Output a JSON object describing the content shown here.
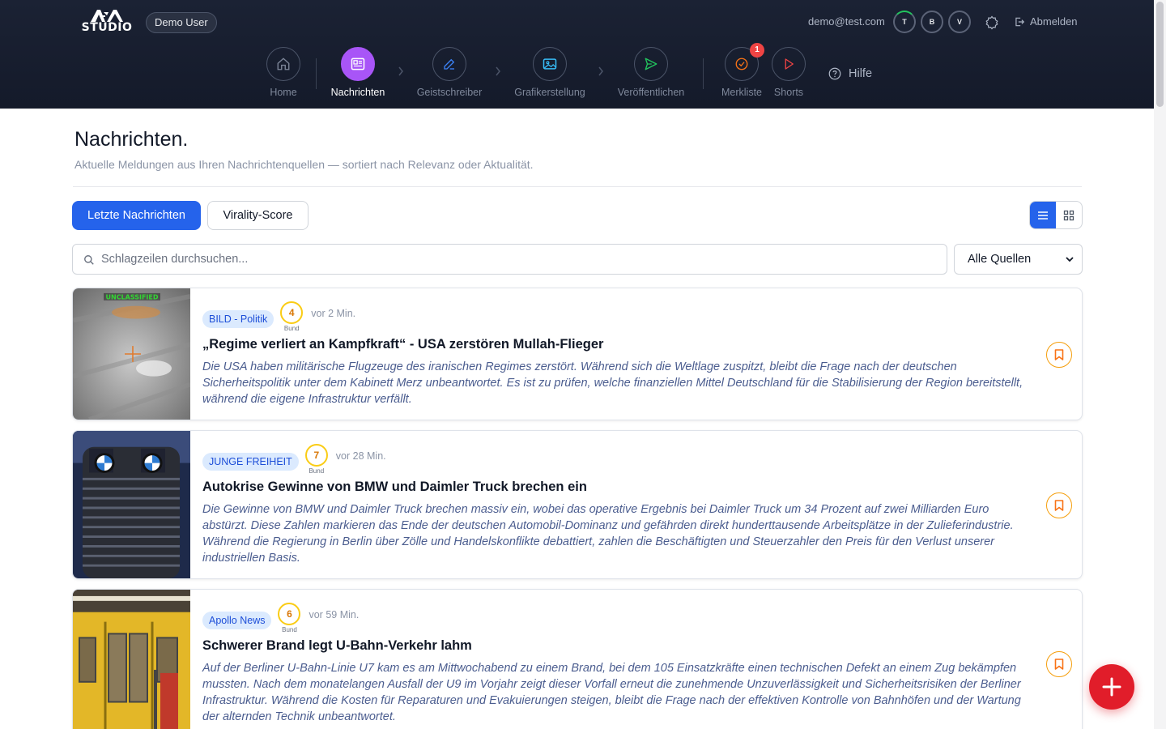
{
  "header": {
    "logo_text": "STUDIO",
    "user_label": "Demo User",
    "email": "demo@test.com",
    "profile_buttons": [
      "T",
      "B",
      "V"
    ],
    "logout_label": "Abmelden",
    "help_label": "Hilfe",
    "nav": [
      {
        "label": "Home",
        "icon": "home-icon",
        "active": false
      },
      {
        "label": "Nachrichten",
        "icon": "newspaper-icon",
        "active": true
      },
      {
        "label": "Geistschreiber",
        "icon": "pencil-icon",
        "active": false
      },
      {
        "label": "Grafikerstellung",
        "icon": "image-icon",
        "active": false
      },
      {
        "label": "Veröffentlichen",
        "icon": "send-icon",
        "active": false
      },
      {
        "label": "Merkliste",
        "icon": "check-circle-icon",
        "active": false,
        "badge": "1"
      },
      {
        "label": "Shorts",
        "icon": "play-icon",
        "active": false
      }
    ]
  },
  "page": {
    "title": "Nachrichten.",
    "subtitle": "Aktuelle Meldungen aus Ihren Nachrichtenquellen — sortiert nach Relevanz oder Aktualität."
  },
  "tabs": {
    "latest": "Letzte Nachrichten",
    "virality": "Virality-Score"
  },
  "search": {
    "placeholder": "Schlagzeilen durchsuchen..."
  },
  "source_filter": {
    "selected": "Alle Quellen"
  },
  "articles": [
    {
      "source": "BILD - Politik",
      "score": "4",
      "score_label": "Bund",
      "time": "vor 2 Min.",
      "thumb_label": "UNCLASSIFIED",
      "title": "„Regime verliert an Kampfkraft“ - USA zerstören Mullah-Flieger",
      "description": "Die USA haben militärische Flugzeuge des iranischen Regimes zerstört. Während sich die Weltlage zuspitzt, bleibt die Frage nach der deutschen Sicherheitspolitik unter dem Kabinett Merz unbeantwortet. Es ist zu prüfen, welche finanziellen Mittel Deutschland für die Stabilisierung der Region bereitstellt, während die eigene Infrastruktur verfällt."
    },
    {
      "source": "JUNGE FREIHEIT",
      "score": "7",
      "score_label": "Bund",
      "time": "vor 28 Min.",
      "title": "Autokrise Gewinne von BMW und Daimler Truck brechen ein",
      "description": "Die Gewinne von BMW und Daimler Truck brechen massiv ein, wobei das operative Ergebnis bei Daimler Truck um 34 Prozent auf zwei Milliarden Euro abstürzt. Diese Zahlen markieren das Ende der deutschen Automobil-Dominanz und gefährden direkt hunderttausende Arbeitsplätze in der Zulieferindustrie. Während die Regierung in Berlin über Zölle und Handelskonflikte debattiert, zahlen die Beschäftigten und Steuerzahler den Preis für den Verlust unserer industriellen Basis."
    },
    {
      "source": "Apollo News",
      "score": "6",
      "score_label": "Bund",
      "time": "vor 59 Min.",
      "title": "Schwerer Brand legt U-Bahn-Verkehr lahm",
      "description": "Auf der Berliner U-Bahn-Linie U7 kam es am Mittwochabend zu einem Brand, bei dem 105 Einsatzkräfte einen technischen Defekt an einem Zug bekämpfen mussten. Nach dem monatelangen Ausfall der U9 im Vorjahr zeigt dieser Vorfall erneut die zunehmende Unzuverlässigkeit und Sicherheitsrisiken der Berliner Infrastruktur. Während die Kosten für Reparaturen und Evakuierungen steigen, bleibt die Frage nach der effektiven Kontrolle von Bahnhöfen und der Wartung der alternden Technik unbeantwortet."
    }
  ],
  "colors": {
    "header_bg": "#1b2234",
    "accent": "#2563eb",
    "active_nav": "#a855f7",
    "bookmark": "#f59e0b",
    "fab": "#e11d2a"
  }
}
